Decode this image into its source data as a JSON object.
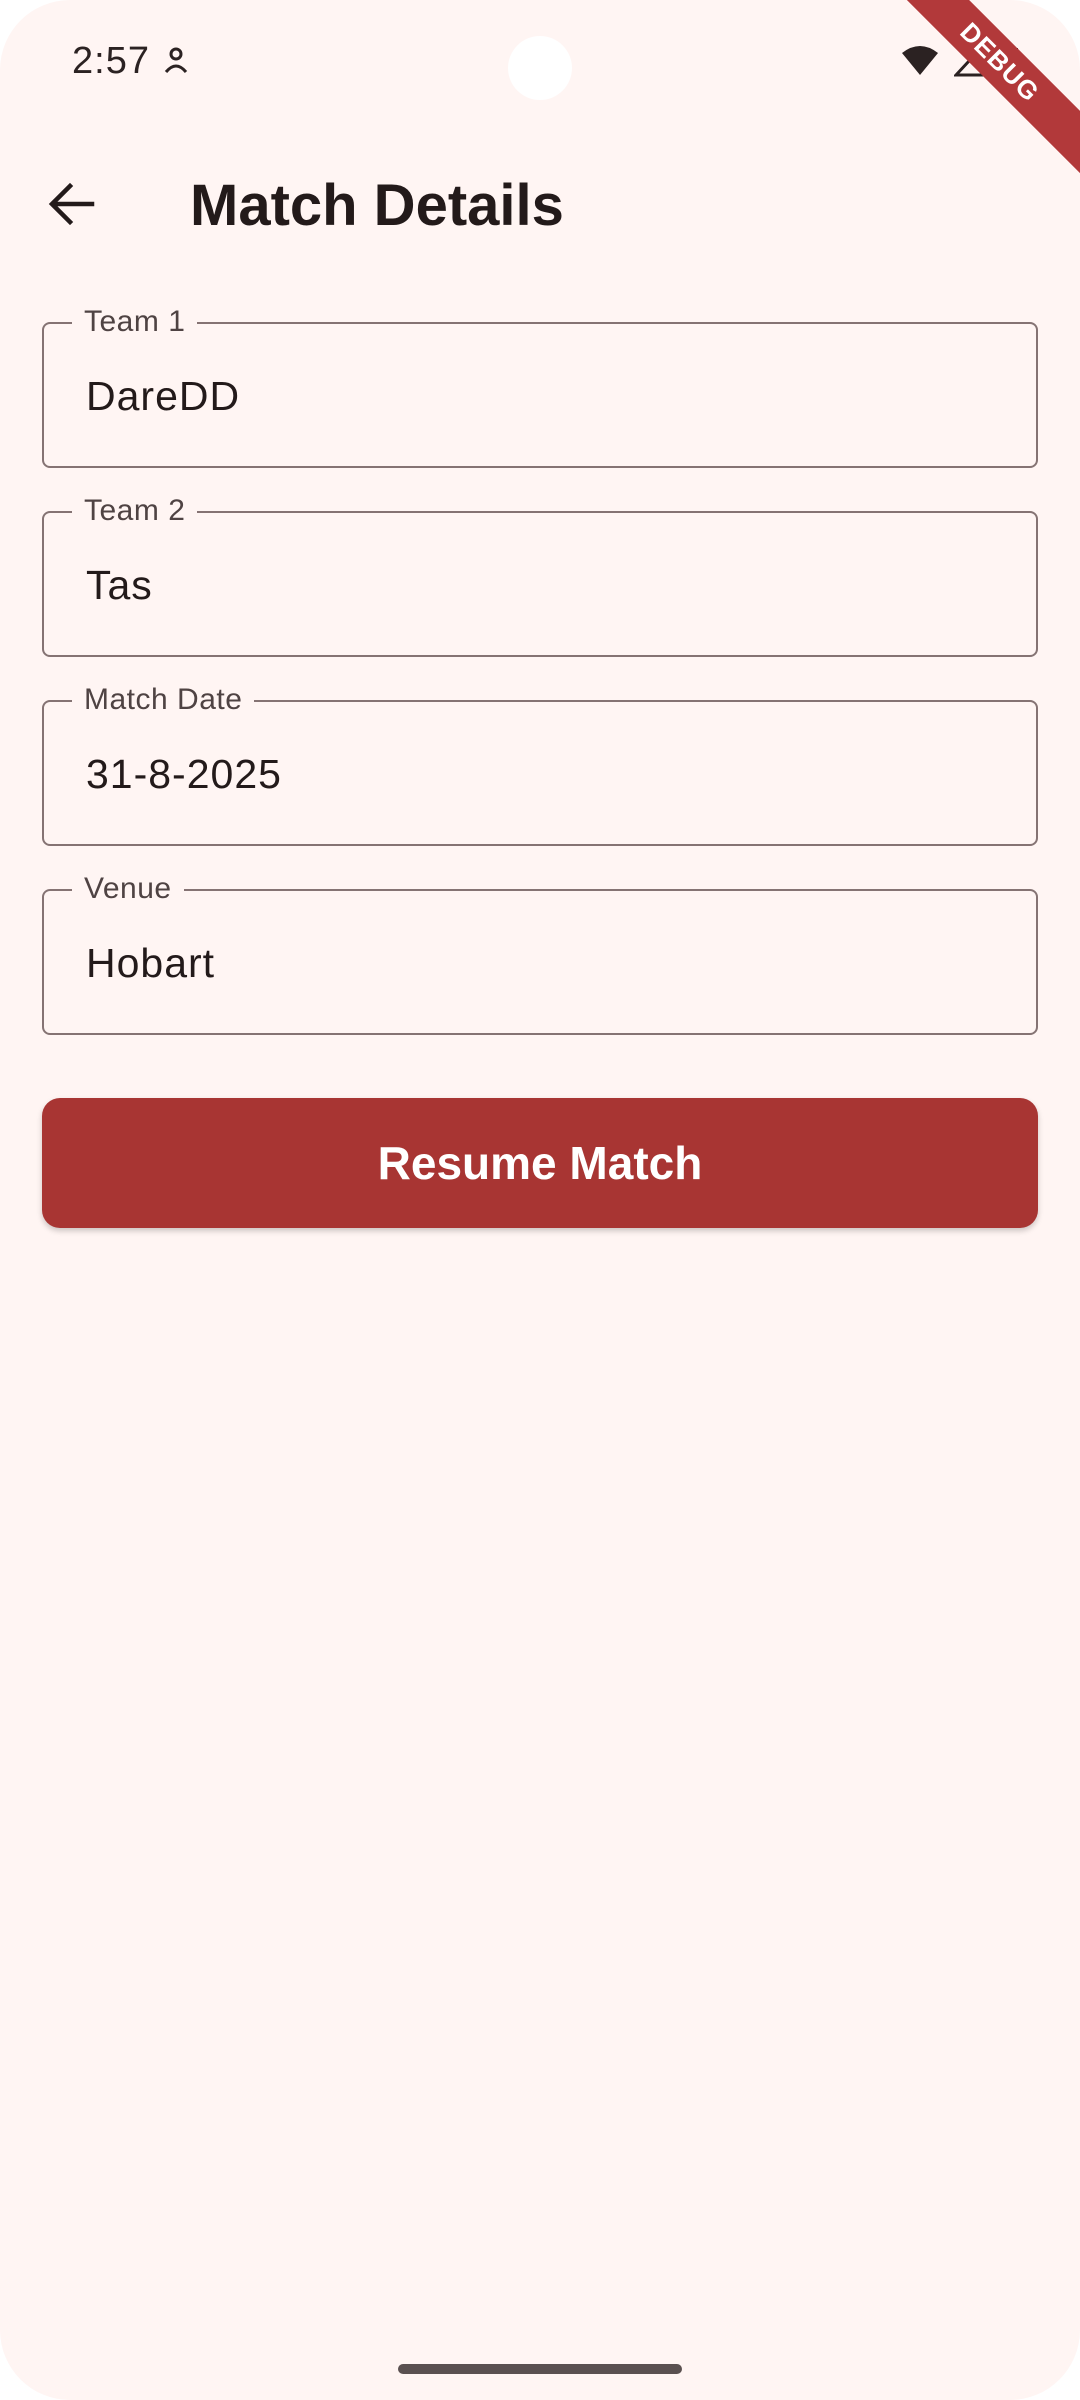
{
  "status_bar": {
    "time": "2:57",
    "icons": [
      "notification-icon",
      "wifi-icon",
      "signal-icon",
      "battery-icon"
    ],
    "debug_banner": "DEBUG"
  },
  "app_bar": {
    "back_icon": "arrow-back-icon",
    "title": "Match Details"
  },
  "form": {
    "fields": [
      {
        "label": "Team 1",
        "value": "DareDD"
      },
      {
        "label": "Team 2",
        "value": "Tas"
      },
      {
        "label": "Match Date",
        "value": "31-8-2025"
      },
      {
        "label": "Venue",
        "value": "Hobart"
      }
    ],
    "resume_button_label": "Resume Match"
  },
  "colors": {
    "background": "#fff5f3",
    "accent": "#a83533",
    "debug_ribbon": "#b2393a",
    "text": "#231a1a",
    "outline": "#857373"
  }
}
